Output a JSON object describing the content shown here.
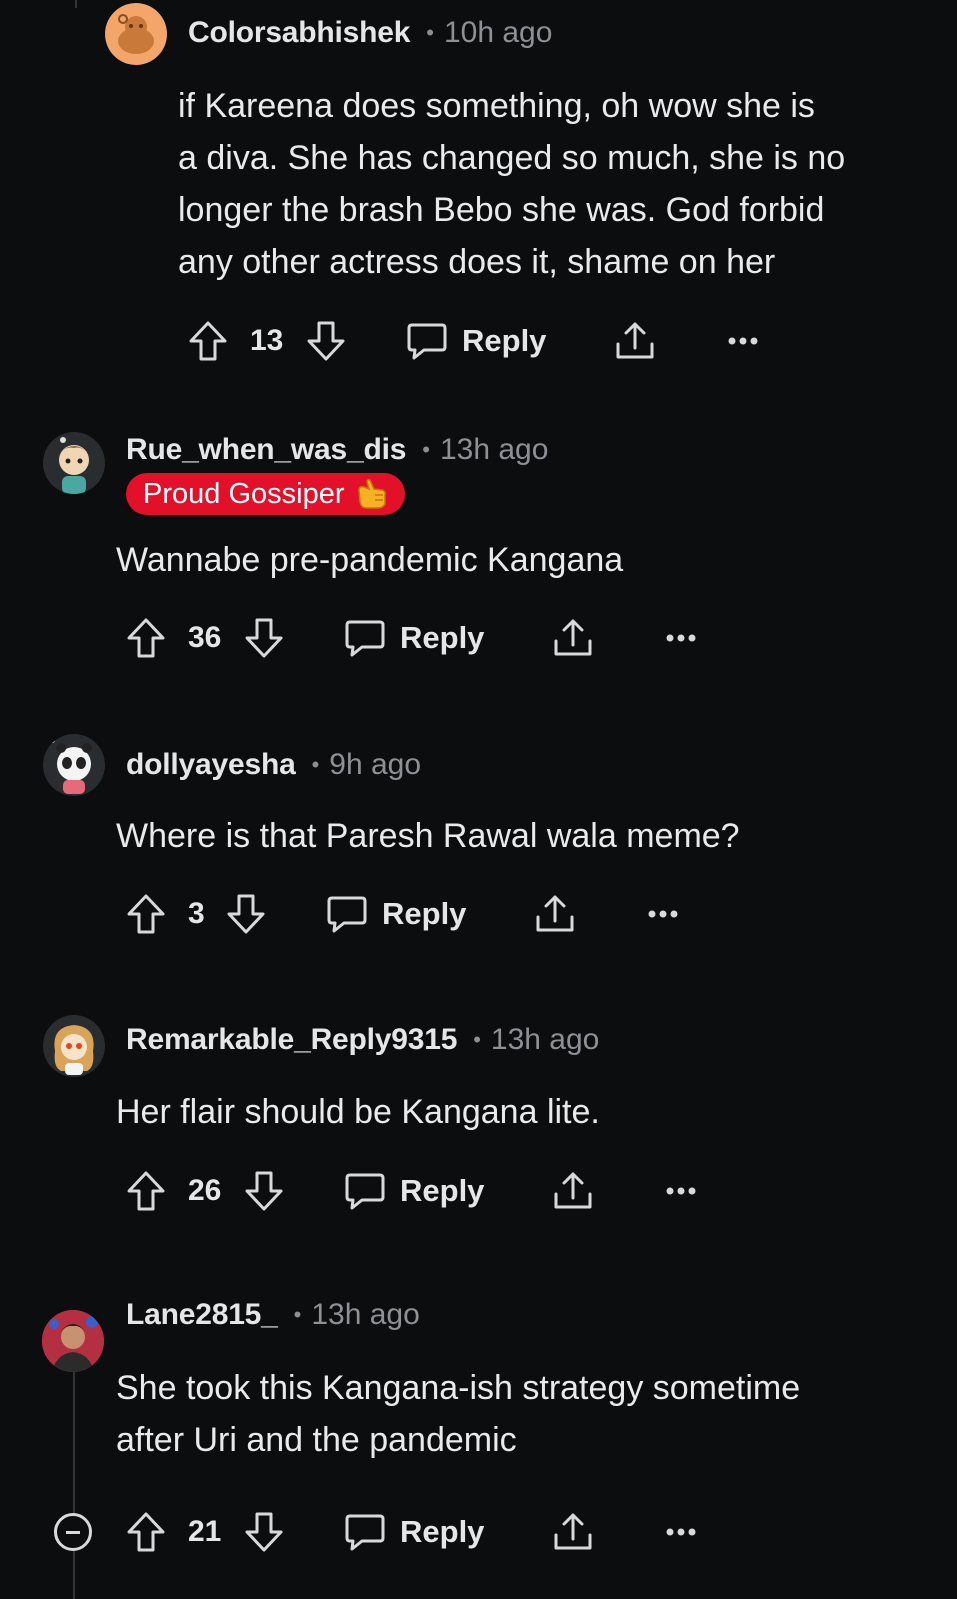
{
  "comments": [
    {
      "username": "Colorsabhishek",
      "time": "10h ago",
      "flair": null,
      "body": "if Kareena does something, oh wow she is\na diva. She has changed so much, she is no\nlonger the brash Bebo she was. God forbid\nany other actress does it, shame on her",
      "votes": "13",
      "reply_label": "Reply",
      "avatar": "snoo-orange-avatar"
    },
    {
      "username": "Rue_when_was_dis",
      "time": "13h ago",
      "flair": "Proud Gossiper",
      "flair_emoji": "call-me-hand-emoji",
      "body": "Wannabe pre-pandemic Kangana",
      "votes": "36",
      "reply_label": "Reply",
      "avatar": "snoo-cartoon-avatar"
    },
    {
      "username": "dollyayesha",
      "time": "9h ago",
      "flair": null,
      "body": "Where is that Paresh Rawal wala meme?",
      "votes": "3",
      "reply_label": "Reply",
      "avatar": "snoo-panda-avatar"
    },
    {
      "username": "Remarkable_Reply9315",
      "time": "13h ago",
      "flair": null,
      "body": "Her flair should be Kangana lite.",
      "votes": "26",
      "reply_label": "Reply",
      "avatar": "snoo-girl-avatar"
    },
    {
      "username": "Lane2815_",
      "time": "13h ago",
      "flair": null,
      "body": "She took this Kangana-ish strategy sometime\nafter Uri and the pandemic",
      "votes": "21",
      "reply_label": "Reply",
      "avatar": "photo-avatar"
    }
  ],
  "colors": {
    "background": "#0b0d0f",
    "text": "#e8eaed",
    "muted": "#8d9196",
    "flair_bg": "#e3102a",
    "thread_line": "#343536"
  }
}
